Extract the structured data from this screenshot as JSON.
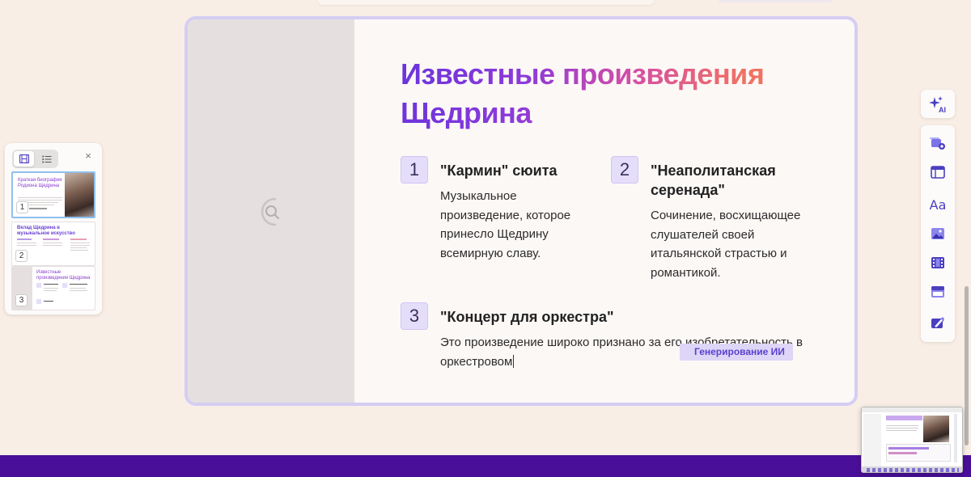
{
  "slide": {
    "title": "Известные произведения Щедрина",
    "items": [
      {
        "number": "1",
        "title": "\"Кармин\" сюита",
        "body": "Музыкальное произведение, которое принесло Щедрину всемирную славу."
      },
      {
        "number": "2",
        "title": "\"Неаполитанская серенада\"",
        "body": "Сочинение, восхищающее слушателей своей итальянской страстью и романтикой."
      },
      {
        "number": "3",
        "title": "\"Концерт для оркестра\"",
        "body": "Это произведение широко признано за его изобретательность в оркестровом"
      }
    ],
    "ai_badge": "Генерирование ИИ"
  },
  "thumbnails": [
    {
      "number": "1",
      "title": "Краткая биография Родиона Щедрина",
      "selected": true
    },
    {
      "number": "2",
      "title": "Вклад Щедрина в музыкальное искусство",
      "selected": false
    },
    {
      "number": "3",
      "title": "Известные произведения Щедрина",
      "selected": false
    }
  ],
  "toolbar": {
    "ai_label": "AI",
    "tools": [
      "add-slide-icon",
      "layout-icon",
      "text-icon",
      "image-icon",
      "video-icon",
      "table-icon",
      "edit-icon"
    ],
    "text_tool_glyph": "Aa"
  },
  "panel": {
    "close_glyph": "×"
  },
  "colors": {
    "accent_purple": "#6a34dc",
    "accent_coral": "#f07263",
    "bottom_bar": "#4a0f98",
    "number_box": "#e5defa"
  }
}
